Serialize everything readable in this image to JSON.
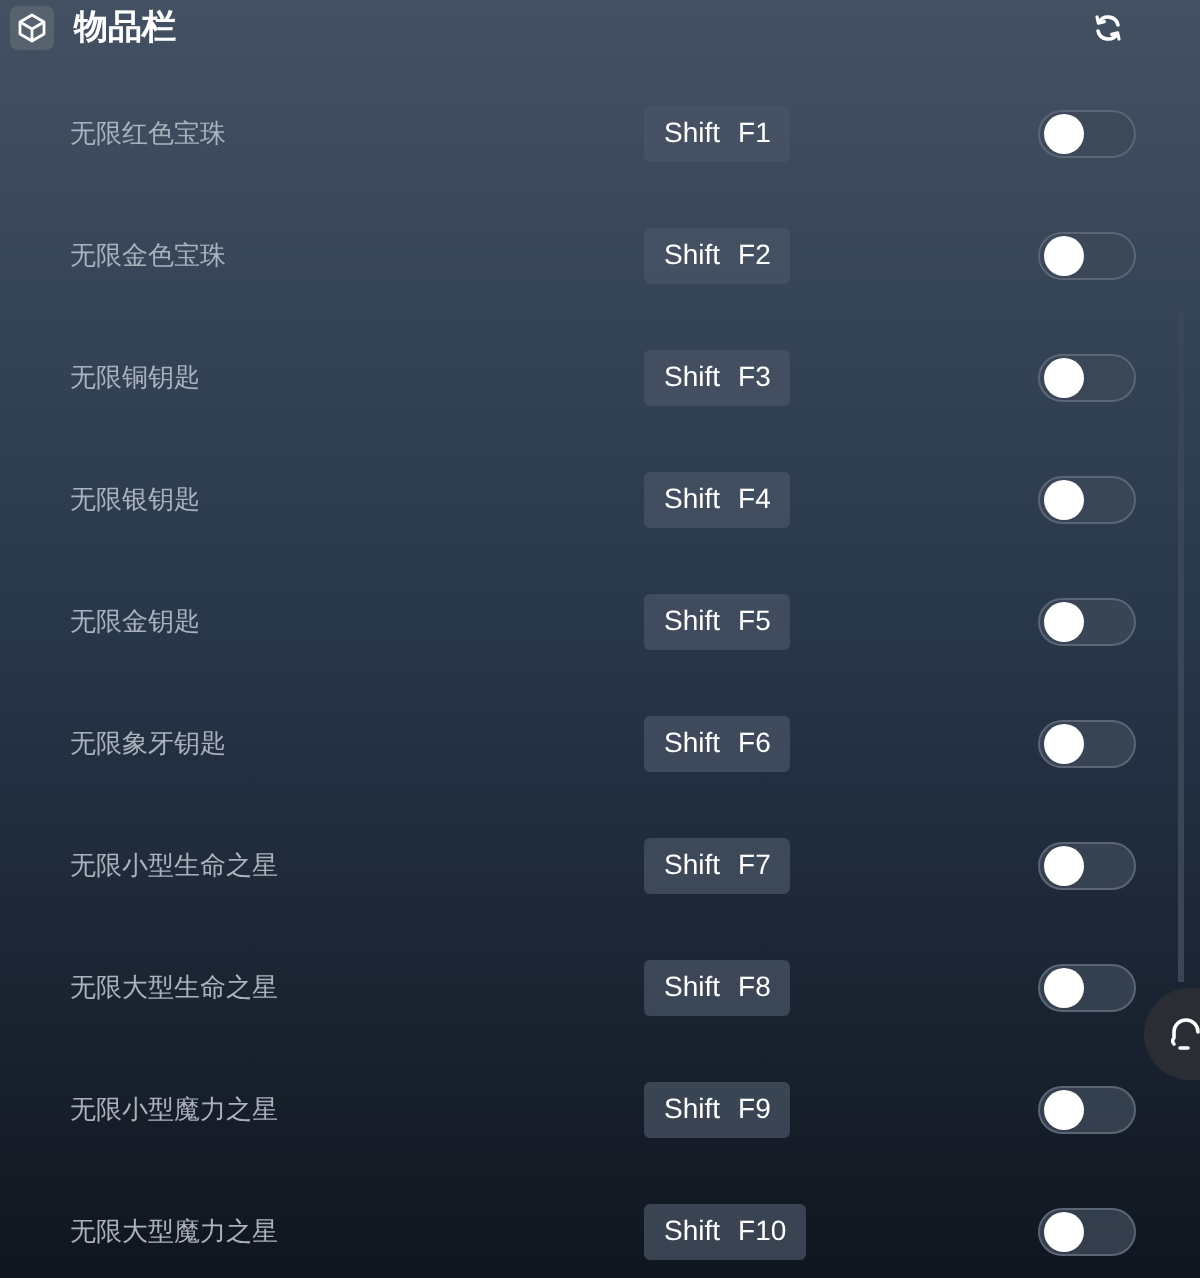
{
  "header": {
    "title": "物品栏"
  },
  "items": [
    {
      "label": "无限红色宝珠",
      "modifier": "Shift",
      "key": "F1",
      "on": false
    },
    {
      "label": "无限金色宝珠",
      "modifier": "Shift",
      "key": "F2",
      "on": false
    },
    {
      "label": "无限铜钥匙",
      "modifier": "Shift",
      "key": "F3",
      "on": false
    },
    {
      "label": "无限银钥匙",
      "modifier": "Shift",
      "key": "F4",
      "on": false
    },
    {
      "label": "无限金钥匙",
      "modifier": "Shift",
      "key": "F5",
      "on": false
    },
    {
      "label": "无限象牙钥匙",
      "modifier": "Shift",
      "key": "F6",
      "on": false
    },
    {
      "label": "无限小型生命之星",
      "modifier": "Shift",
      "key": "F7",
      "on": false
    },
    {
      "label": "无限大型生命之星",
      "modifier": "Shift",
      "key": "F8",
      "on": false
    },
    {
      "label": "无限小型魔力之星",
      "modifier": "Shift",
      "key": "F9",
      "on": false
    },
    {
      "label": "无限大型魔力之星",
      "modifier": "Shift",
      "key": "F10",
      "on": false
    }
  ]
}
